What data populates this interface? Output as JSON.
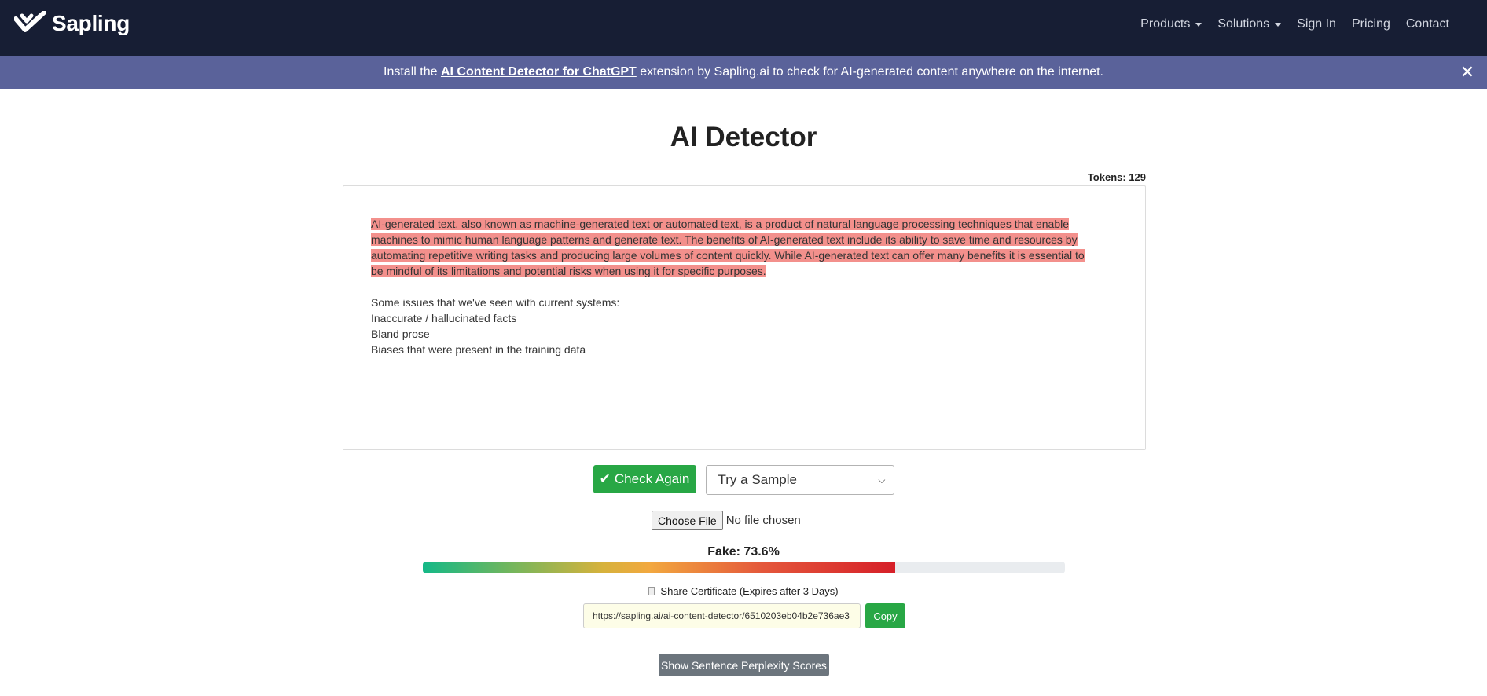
{
  "nav": {
    "brand": "Sapling",
    "items": [
      {
        "label": "Products",
        "has_dropdown": true
      },
      {
        "label": "Solutions",
        "has_dropdown": true
      },
      {
        "label": "Sign In",
        "has_dropdown": false
      },
      {
        "label": "Pricing",
        "has_dropdown": false
      },
      {
        "label": "Contact",
        "has_dropdown": false
      }
    ]
  },
  "banner": {
    "prefix": "Install the ",
    "link_text": "AI Content Detector for ChatGPT",
    "suffix": " extension by Sapling.ai to check for AI-generated content anywhere on the internet.",
    "close_symbol": "✕"
  },
  "page": {
    "title": "AI Detector",
    "tokens_label": "Tokens: 129"
  },
  "editor": {
    "highlighted_lines": [
      "AI-generated text, also known as machine-generated text or automated text, is a product of natural language processing techniques that enable",
      "machines to mimic human language patterns and generate text. The benefits of AI-generated text include its ability to save time and resources by",
      "automating repetitive writing tasks and producing large volumes of content quickly. While AI-generated text can offer many benefits it is essential to",
      "be mindful of its limitations and potential risks when using it for specific purposes."
    ],
    "plain_lines": [
      "Some issues that we've seen with current systems:",
      "Inaccurate / hallucinated facts",
      "Bland prose",
      "Biases that were present in the training data"
    ]
  },
  "controls": {
    "check_button": "Check Again",
    "sample_select": "Try a Sample",
    "file_button": "Choose File",
    "file_status": "No file chosen"
  },
  "result": {
    "label": "Fake: 73.6%",
    "fake_percent": 73.6,
    "share_label": "Share Certificate (Expires after 3 Days)",
    "share_url": "https://sapling.ai/ai-content-detector/6510203eb04b2e736ae3",
    "copy_button": "Copy",
    "perplexity_button": "Show Sentence Perplexity Scores"
  },
  "colors": {
    "nav_bg": "#171e34",
    "banner_bg": "#5a629a",
    "highlight": "#f3908c",
    "green": "#28a745",
    "gray_button": "#6c757d"
  }
}
